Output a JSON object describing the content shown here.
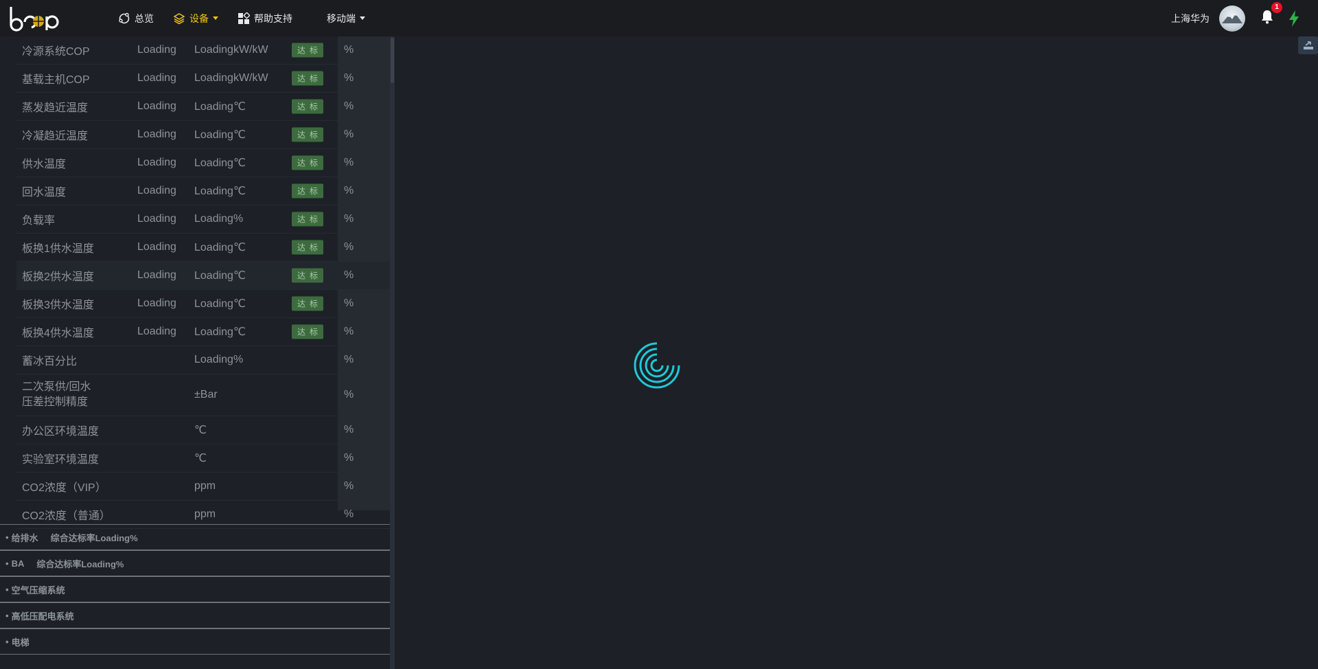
{
  "brand": {
    "logo_text": "beep"
  },
  "nav": {
    "overview_label": "总览",
    "devices_label": "设备",
    "help_label": "帮助支持",
    "mobile_label": "移动端"
  },
  "header": {
    "company": "上海华为",
    "notification_count": "1"
  },
  "kpi_rows": [
    {
      "name": "冷源系统COP",
      "value": "Loading",
      "unit": "LoadingkW/kW",
      "badge": "达标",
      "pct": "%"
    },
    {
      "name": "基载主机COP",
      "value": "Loading",
      "unit": "LoadingkW/kW",
      "badge": "达标",
      "pct": "%"
    },
    {
      "name": "蒸发趋近温度",
      "value": "Loading",
      "unit": "Loading℃",
      "badge": "达标",
      "pct": "%"
    },
    {
      "name": "冷凝趋近温度",
      "value": "Loading",
      "unit": "Loading℃",
      "badge": "达标",
      "pct": "%"
    },
    {
      "name": "供水温度",
      "value": "Loading",
      "unit": "Loading℃",
      "badge": "达标",
      "pct": "%"
    },
    {
      "name": "回水温度",
      "value": "Loading",
      "unit": "Loading℃",
      "badge": "达标",
      "pct": "%"
    },
    {
      "name": "负载率",
      "value": "Loading",
      "unit": "Loading%",
      "badge": "达标",
      "pct": "%"
    },
    {
      "name": "板换1供水温度",
      "value": "Loading",
      "unit": "Loading℃",
      "badge": "达标",
      "pct": "%"
    },
    {
      "name": "板换2供水温度",
      "value": "Loading",
      "unit": "Loading℃",
      "badge": "达标",
      "pct": "%"
    },
    {
      "name": "板换3供水温度",
      "value": "Loading",
      "unit": "Loading℃",
      "badge": "达标",
      "pct": "%"
    },
    {
      "name": "板换4供水温度",
      "value": "Loading",
      "unit": "Loading℃",
      "badge": "达标",
      "pct": "%"
    },
    {
      "name": "蓄冰百分比",
      "value": "",
      "unit": "Loading%",
      "badge": "",
      "pct": "%"
    },
    {
      "name_line1": "二次泵供/回水",
      "name_line2": "压差控制精度",
      "value": "",
      "unit": "±Bar",
      "badge": "",
      "pct": "%"
    },
    {
      "name": "办公区环境温度",
      "value": "",
      "unit": "℃",
      "badge": "",
      "pct": "%"
    },
    {
      "name": "实验室环境温度",
      "value": "",
      "unit": "℃",
      "badge": "",
      "pct": "%"
    },
    {
      "name": "CO2浓度（VIP）",
      "value": "",
      "unit": "ppm",
      "badge": "",
      "pct": "%"
    },
    {
      "name": "CO2浓度（普通）",
      "value": "",
      "unit": "ppm",
      "badge": "",
      "pct": "%"
    }
  ],
  "sections": [
    {
      "title": "给排水",
      "rate": "综合达标率Loading%"
    },
    {
      "title": "BA",
      "rate": "综合达标率Loading%"
    },
    {
      "title": "空气压缩系统",
      "rate": ""
    },
    {
      "title": "高低压配电系统",
      "rate": ""
    },
    {
      "title": "电梯",
      "rate": ""
    }
  ],
  "colors": {
    "accent": "#f2c314",
    "spinner": "#1fc9d6",
    "badge_bg": "#3d6b3f",
    "notify": "#e8102b",
    "bolt": "#2bb34a"
  }
}
